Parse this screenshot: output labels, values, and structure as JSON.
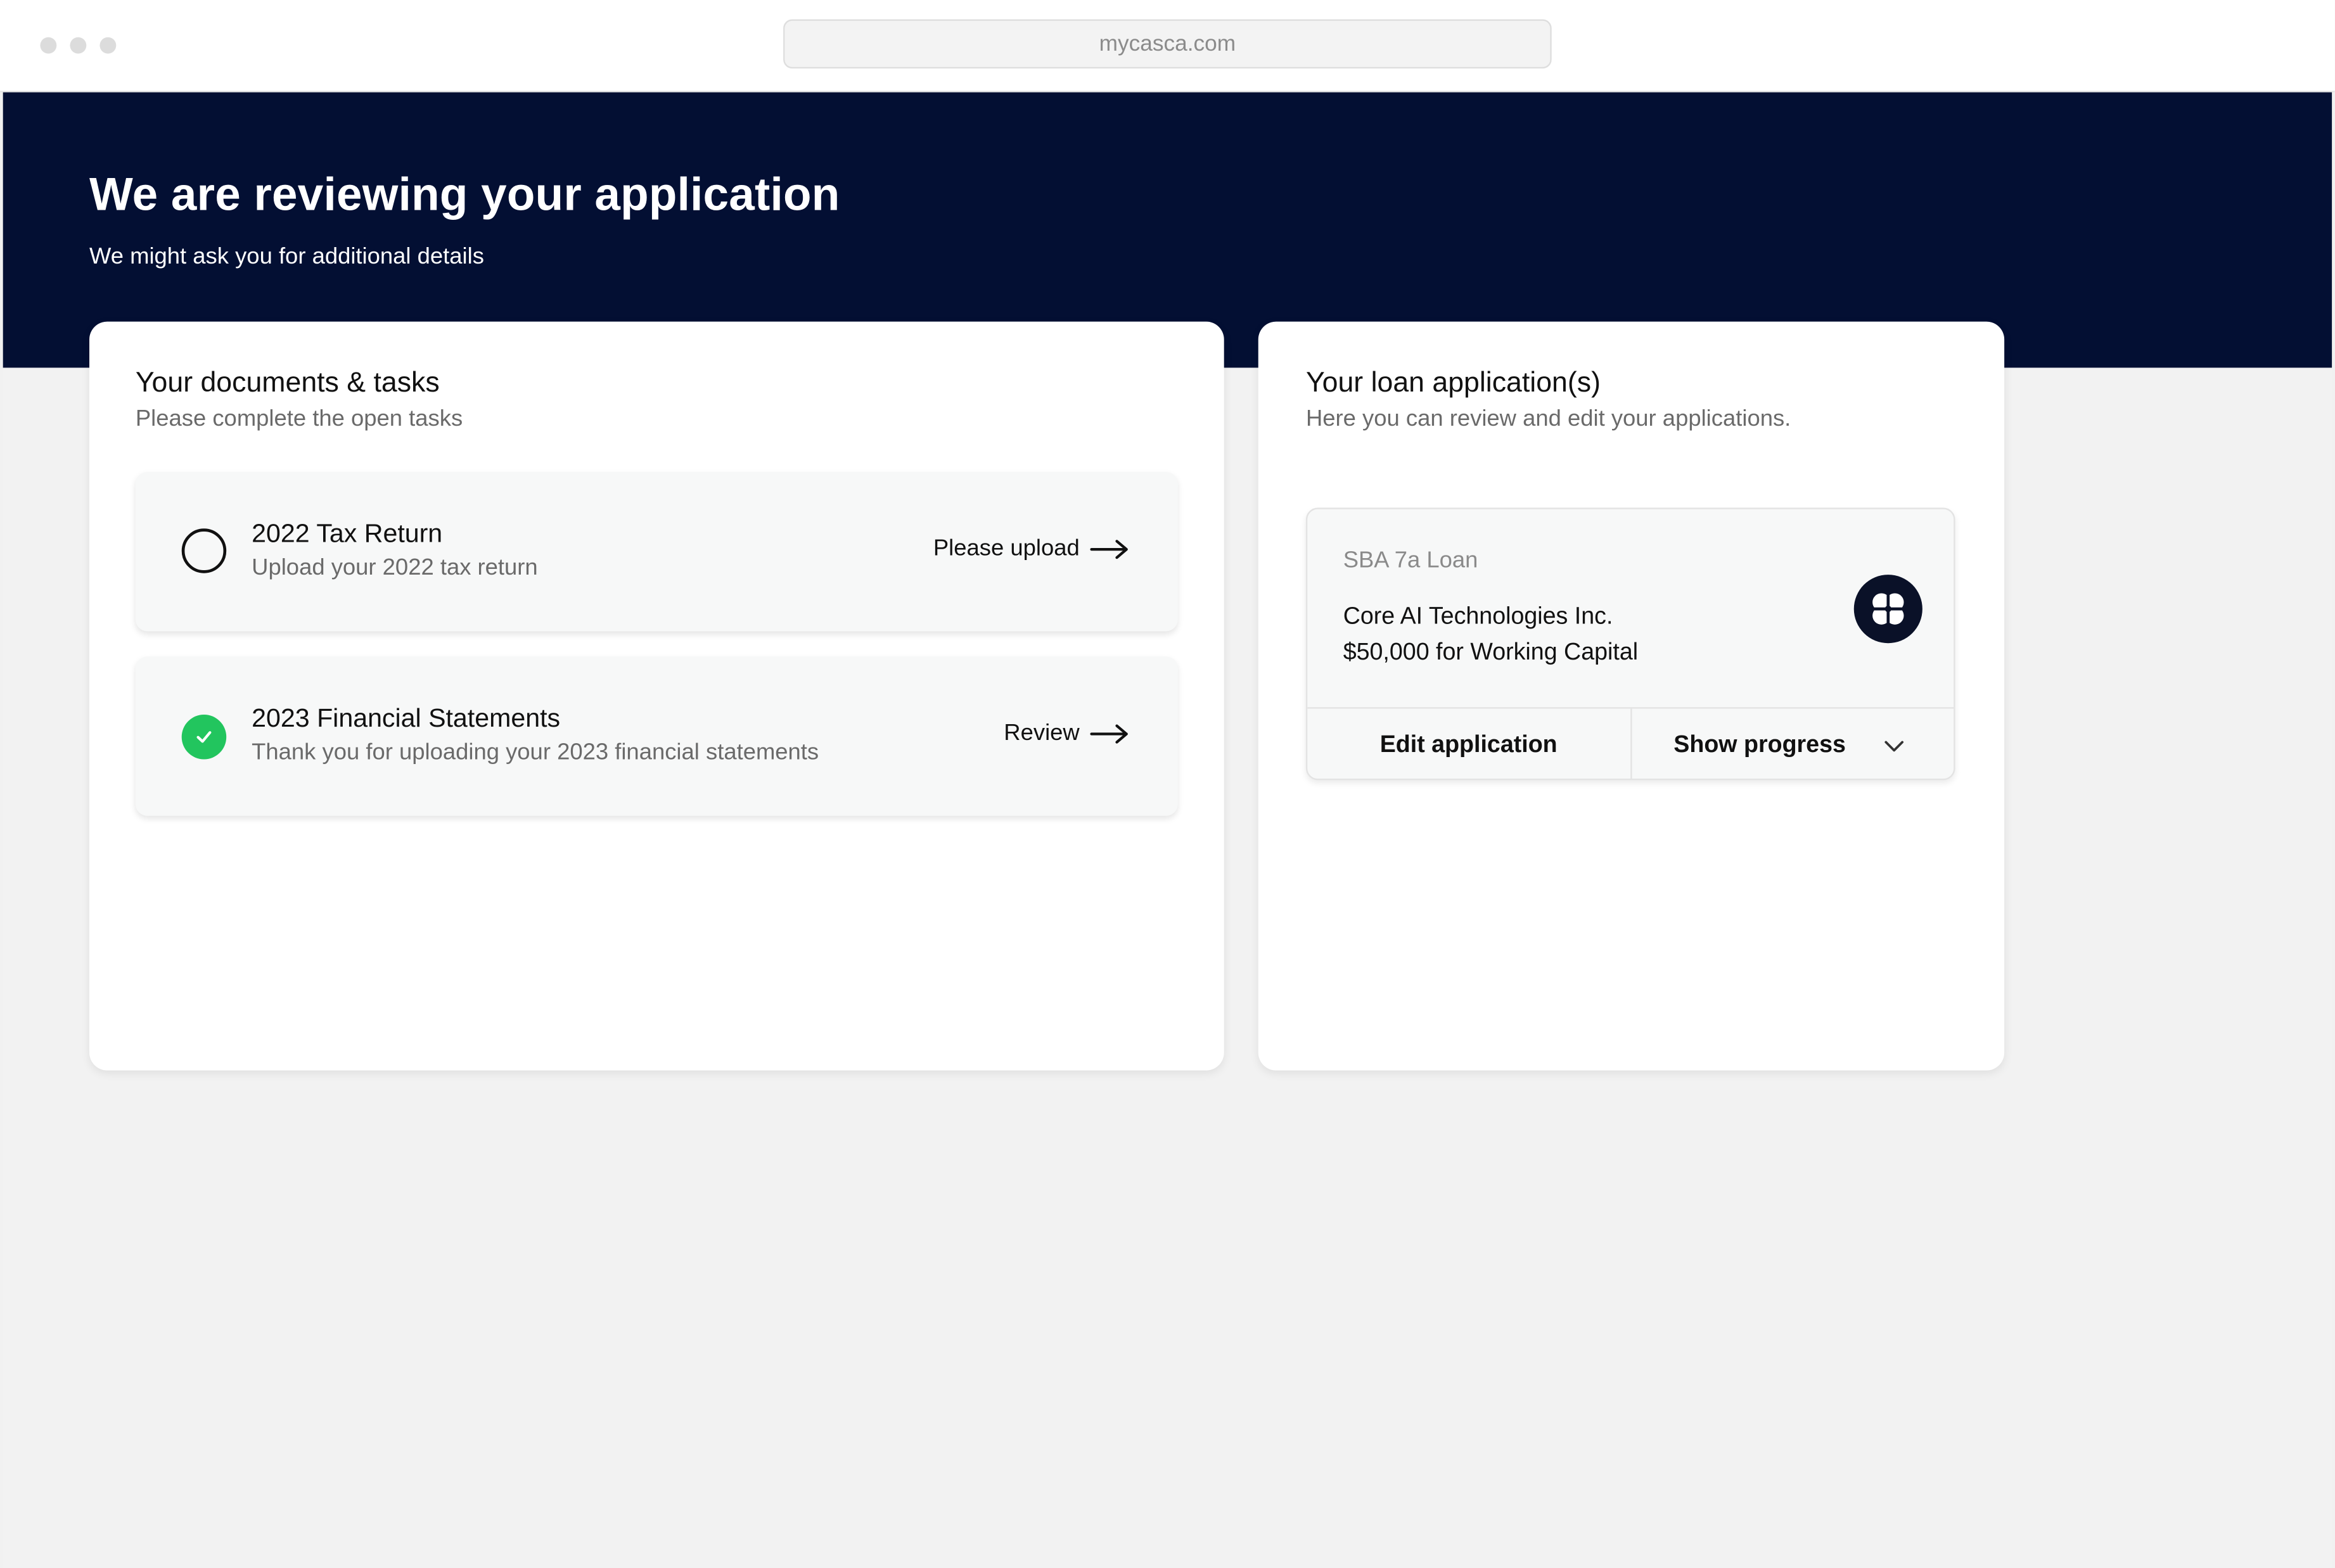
{
  "browser": {
    "url": "mycasca.com"
  },
  "hero": {
    "title": "We are reviewing your application",
    "subtitle": "We might ask you for additional details"
  },
  "documents": {
    "title": "Your documents & tasks",
    "subtitle": "Please complete the open tasks",
    "tasks": [
      {
        "title": "2022 Tax Return",
        "description": "Upload your 2022 tax return",
        "action": "Please upload",
        "status": "open",
        "status_icon": "empty-circle-icon"
      },
      {
        "title": "2023 Financial Statements",
        "description": "Thank you for uploading your 2023 financial statements",
        "action": "Review",
        "status": "done",
        "status_icon": "green-check-icon"
      }
    ]
  },
  "loans": {
    "title": "Your loan application(s)",
    "subtitle": "Here you can review and edit your applications.",
    "items": [
      {
        "type": "SBA 7a Loan",
        "company": "Core AI Technologies Inc.",
        "amount": "$50,000 for Working Capital",
        "logo_icon": "clover-logo-icon",
        "edit_label": "Edit application",
        "progress_label": "Show progress"
      }
    ]
  },
  "colors": {
    "hero_bg": "#030f33",
    "success": "#22c55e",
    "text": "#111111",
    "muted": "#6a6a6a"
  }
}
